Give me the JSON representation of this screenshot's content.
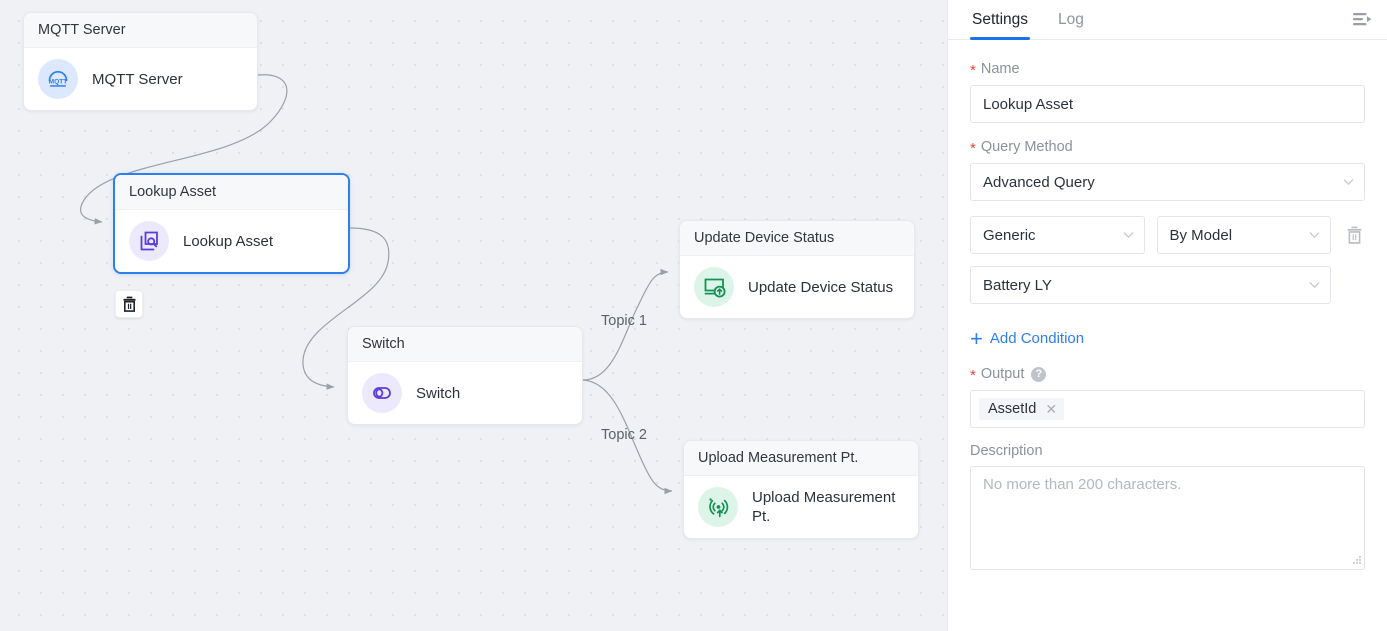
{
  "canvas": {
    "nodes": [
      {
        "id": "mqtt",
        "title": "MQTT Server",
        "label": "MQTT Server",
        "icon": "mqtt-cloud-icon",
        "icon_color": "#2f7eed",
        "icon_bg": "#dbe8fe"
      },
      {
        "id": "lookup",
        "title": "Lookup Asset",
        "label": "Lookup Asset",
        "icon": "asset-search-icon",
        "icon_color": "#5b3cdb",
        "icon_bg": "#ece9fd",
        "selected": true
      },
      {
        "id": "switch",
        "title": "Switch",
        "label": "Switch",
        "icon": "toggle-switch-icon",
        "icon_color": "#5b3cdb",
        "icon_bg": "#ece9fd"
      },
      {
        "id": "update",
        "title": "Update Device Status",
        "label": "Update Device Status",
        "icon": "monitor-upload-icon",
        "icon_color": "#159157",
        "icon_bg": "#ddf5e8"
      },
      {
        "id": "upload",
        "title": "Upload Measurement Pt.",
        "label": "Upload Measurement Pt.",
        "icon": "signal-upload-icon",
        "icon_color": "#159157",
        "icon_bg": "#ddf5e8"
      }
    ],
    "edge_labels": {
      "topic1": "Topic 1",
      "topic2": "Topic 2"
    },
    "delete_node_icon": "trash-icon",
    "background_color": "#eff1f5",
    "dot_color": "#dcdfe6",
    "edge_color": "#9ba0a8"
  },
  "panel": {
    "tabs": [
      {
        "id": "settings",
        "label": "Settings",
        "active": true
      },
      {
        "id": "log",
        "label": "Log",
        "active": false
      }
    ],
    "collapse_icon": "collapse-panel-icon",
    "accent_color": "#1a73e8",
    "form": {
      "name": {
        "label": "Name",
        "required": true,
        "value": "Lookup Asset"
      },
      "query_method": {
        "label": "Query Method",
        "required": true,
        "value": "Advanced Query"
      },
      "condition": {
        "scope": "Generic",
        "mode": "By Model",
        "model": "Battery LY",
        "delete_icon": "trash-icon"
      },
      "add_condition": {
        "label": "Add Condition",
        "icon": "plus-icon"
      },
      "output": {
        "label": "Output",
        "required": true,
        "help_icon": "question-mark-icon",
        "tags": [
          {
            "label": "AssetId",
            "remove_icon": "close-icon"
          }
        ]
      },
      "description": {
        "label": "Description",
        "placeholder": "No more than 200 characters.",
        "value": ""
      }
    }
  }
}
